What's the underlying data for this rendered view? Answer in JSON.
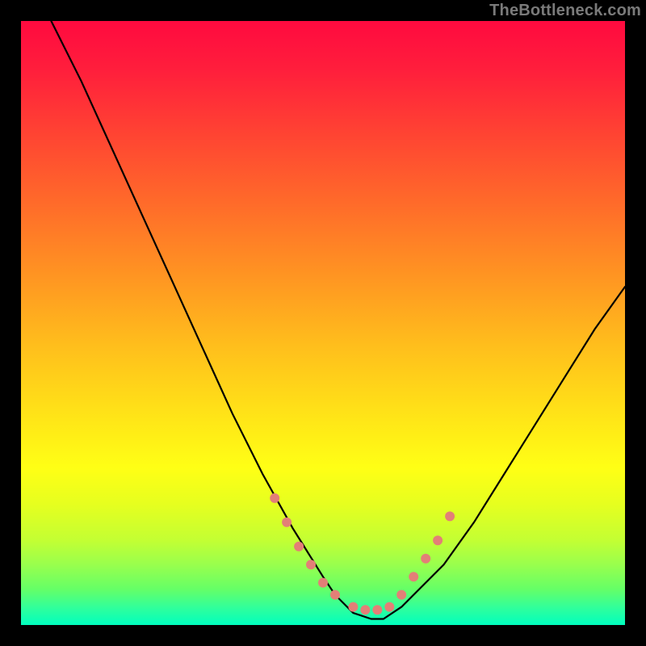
{
  "watermark": "TheBottleneck.com",
  "chart_data": {
    "type": "line",
    "title": "",
    "xlabel": "",
    "ylabel": "",
    "xlim": [
      0,
      100
    ],
    "ylim": [
      0,
      100
    ],
    "grid": false,
    "series": [
      {
        "name": "curve",
        "x": [
          5,
          10,
          15,
          20,
          25,
          30,
          35,
          40,
          45,
          50,
          52,
          55,
          58,
          60,
          63,
          70,
          75,
          80,
          85,
          90,
          95,
          100
        ],
        "y": [
          100,
          90,
          79,
          68,
          57,
          46,
          35,
          25,
          16,
          8,
          5,
          2,
          1,
          1,
          3,
          10,
          17,
          25,
          33,
          41,
          49,
          56
        ]
      }
    ],
    "markers": {
      "name": "highlighted-points",
      "x": [
        42,
        44,
        46,
        48,
        50,
        52,
        55,
        57,
        59,
        61,
        63,
        65,
        67,
        69,
        71
      ],
      "y": [
        21,
        17,
        13,
        10,
        7,
        5,
        3,
        2.5,
        2.5,
        3,
        5,
        8,
        11,
        14,
        18
      ]
    },
    "background_gradient": {
      "top": "#ff0a3f",
      "mid1": "#ff9422",
      "mid2": "#ffff15",
      "bottom": "#00ffbf"
    }
  }
}
